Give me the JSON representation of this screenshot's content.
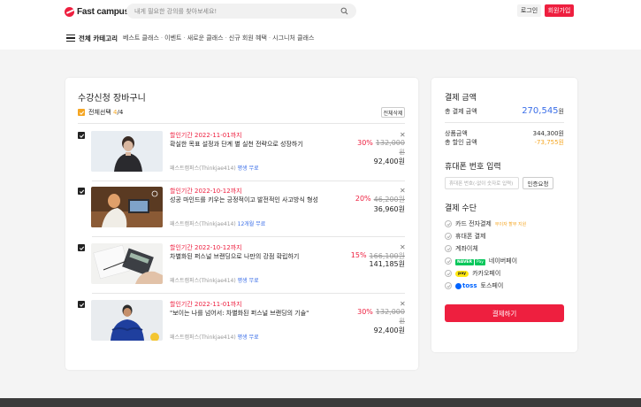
{
  "header": {
    "logo_text": "Fast campus",
    "search_placeholder": "내게 필요한 강의를 찾아보세요!",
    "login_label": "로그인",
    "signup_label": "회원가입"
  },
  "nav": {
    "all_categories": "전체 카테고리",
    "items": [
      "베스트 클래스",
      "이벤트",
      "새로운 클래스",
      "신규 회원 혜택",
      "시그니처 클래스"
    ]
  },
  "cart": {
    "title": "수강신청 장바구니",
    "select_all_label": "전체선택",
    "selected_count": "4",
    "total_count": "/4",
    "delete_selected_label": "전체삭제",
    "items": [
      {
        "period": "할인기간 2022-11-01까지",
        "name": "확실한 목표 설정과 단계 별 실천 전략으로 성장하기",
        "instructor": "패스트캠퍼스(Thinkjae414)",
        "duration": "평생 무료",
        "discount_rate": "30%",
        "original_price": "132,000",
        "original_unit": "원",
        "price": "92,400원"
      },
      {
        "period": "할인기간 2022-10-12까지",
        "name": "성공 마인드를 키우는 긍정적이고 발전적인 사고방식 형성",
        "instructor": "패스트캠퍼스(Thinkjae414)",
        "duration": "12개월 무료",
        "discount_rate": "20%",
        "original_price": "46,200원",
        "original_unit": "",
        "price": "36,960원"
      },
      {
        "period": "할인기간 2022-10-12까지",
        "name": "차별화된 퍼스널 브랜딩으로 나만의 강점 확립하기",
        "instructor": "패스트캠퍼스(Thinkjae414)",
        "duration": "평생 무료",
        "discount_rate": "15%",
        "original_price": "166,100원",
        "original_unit": "",
        "price": "141,185원"
      },
      {
        "period": "할인기간 2022-11-01까지",
        "name": "\"보이는 나를 넘어서: 차별화된 퍼스널 브랜딩의 기술\"",
        "instructor": "패스트캠퍼스(Thinkjae414)",
        "duration": "평생 무료",
        "discount_rate": "30%",
        "original_price": "132,000",
        "original_unit": "원",
        "price": "92,400원"
      }
    ]
  },
  "payment": {
    "amount_title": "결제 금액",
    "total_label": "총 결제 금액",
    "total_value": "270,545",
    "total_unit": "원",
    "product_label": "상품금액",
    "product_value": "344,300원",
    "discount_label": "총 할인 금액",
    "discount_value": "-73,755원",
    "phone_title": "휴대폰 번호 입력",
    "phone_placeholder": "휴대폰 번호(-없이 숫자로 입력)",
    "verify_label": "인증요청",
    "method_title": "결제 수단",
    "methods": {
      "card": "카드 전자결제",
      "card_note": "무이자 할부 지원",
      "phone": "휴대폰 결제",
      "transfer": "계좌이체",
      "naver_badge": "NAVER",
      "naver_pay_badge": "Pay",
      "naver": "네이버페이",
      "kakao_badge": "pay",
      "kakao": "카카오페이",
      "toss_badge": "toss",
      "toss": "토스페이"
    },
    "pay_button": "결제하기"
  },
  "colors": {
    "brand_red": "#ee1f3f",
    "accent_orange": "#f5a623",
    "link_blue": "#3a6ee8"
  }
}
